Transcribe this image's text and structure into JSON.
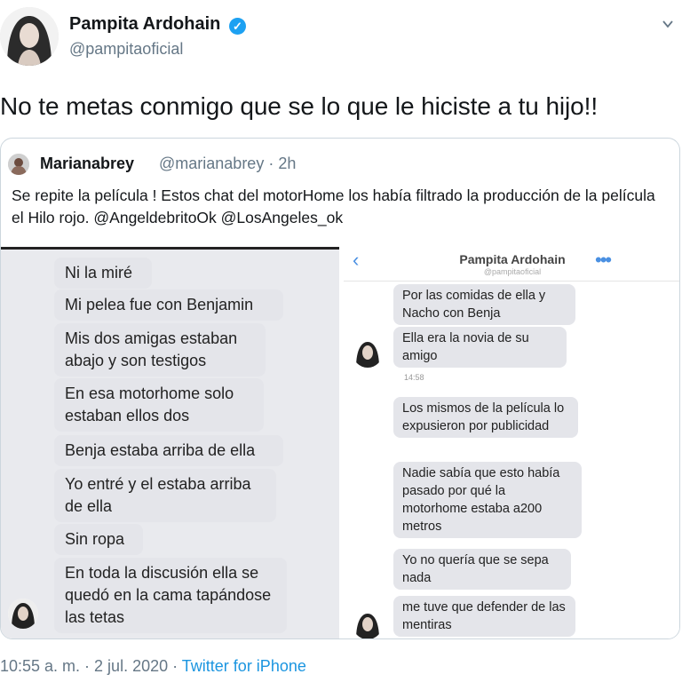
{
  "author": {
    "name": "Pampita Ardohain",
    "handle": "@pampitaoficial",
    "avatar_icon": "profile-photo",
    "verified_icon": "verified-badge-icon",
    "menu_icon": "chevron-down-icon"
  },
  "tweet": {
    "text": "No te metas conmigo que se lo que le hiciste a tu hijo!!"
  },
  "quote": {
    "name": "Marianabrey",
    "handle_time": "@marianabrey · 2h",
    "text": "Se repite la película ! Estos chat del motorHome los había filtrado la producción de la película el Hilo rojo.  @AngeldebritoOk @LosAngeles_ok",
    "image": {
      "left_messages": [
        "Ni la miré",
        "Mi pelea fue con Benjamin",
        "Mis dos amigas estaban abajo y son testigos",
        "En esa motorhome solo estaban ellos dos",
        "Benja estaba arriba de ella",
        "Yo entré y el estaba arriba de ella",
        "Sin ropa",
        "En toda la discusión ella se quedó en la cama tapándose las tetas"
      ],
      "right_header": {
        "title": "Pampita Ardohain",
        "subtitle": "@pampitaoficial",
        "back_icon": "back-chevron-icon",
        "more_icon": "more-dots-icon"
      },
      "right_messages": [
        "Por las comidas de ella y Nacho con Benja",
        "Ella era la novia de su amigo",
        "Los mismos de la película lo expusieron por publicidad",
        "Nadie sabía que esto había pasado por qué la motorhome estaba a200 metros",
        "Yo no quería que se sepa nada",
        "me tuve que defender de las mentiras"
      ],
      "right_time": "14:58"
    }
  },
  "footer": {
    "time_date": "10:55 a. m. · 2 jul. 2020 · ",
    "source": "Twitter for iPhone"
  },
  "colors": {
    "link": "#1b95e0",
    "secondary_text": "#657786",
    "verified": "#1da1f2",
    "bubble": "#e4e5ea"
  }
}
